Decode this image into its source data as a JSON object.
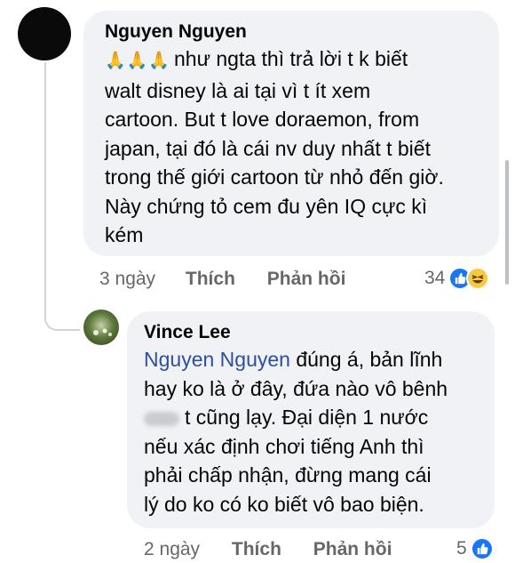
{
  "comment": {
    "author": "Nguyen Nguyen",
    "emoji": "🙏🙏🙏",
    "lines": [
      "như ngta thì trả lời t k biết",
      "walt disney là ai tại vì t ít xem",
      "cartoon. But t love doraemon, from",
      "japan, tại đó là cái nv duy nhất t biết",
      "trong thế giới cartoon từ nhỏ đến giờ.",
      "Này chứng tỏ cem đu yên IQ cực kì",
      "kém"
    ],
    "time": "3 ngày",
    "like_label": "Thích",
    "reply_label": "Phản hồi",
    "reaction_count": "34",
    "reactions": [
      "like-icon",
      "haha-icon"
    ]
  },
  "reply": {
    "author": "Vince Lee",
    "mention": "Nguyen Nguyen",
    "lines": [
      "đúng á, bản lĩnh",
      "hay ko là ở đây, đứa nào vô bênh",
      "t cũng lạy. Đại diện 1 nước",
      "nếu xác định chơi tiếng Anh thì",
      "phải chấp nhận, đừng mang cái",
      "lý do ko có ko biết vô bao biện."
    ],
    "time": "2 ngày",
    "like_label": "Thích",
    "reply_label": "Phản hồi",
    "reaction_count": "5",
    "reactions": [
      "like-icon"
    ]
  },
  "colors": {
    "bubble": "#f0f2f5",
    "mention": "#2c4f9e",
    "meta": "#65676b",
    "like": "#1877f2"
  }
}
